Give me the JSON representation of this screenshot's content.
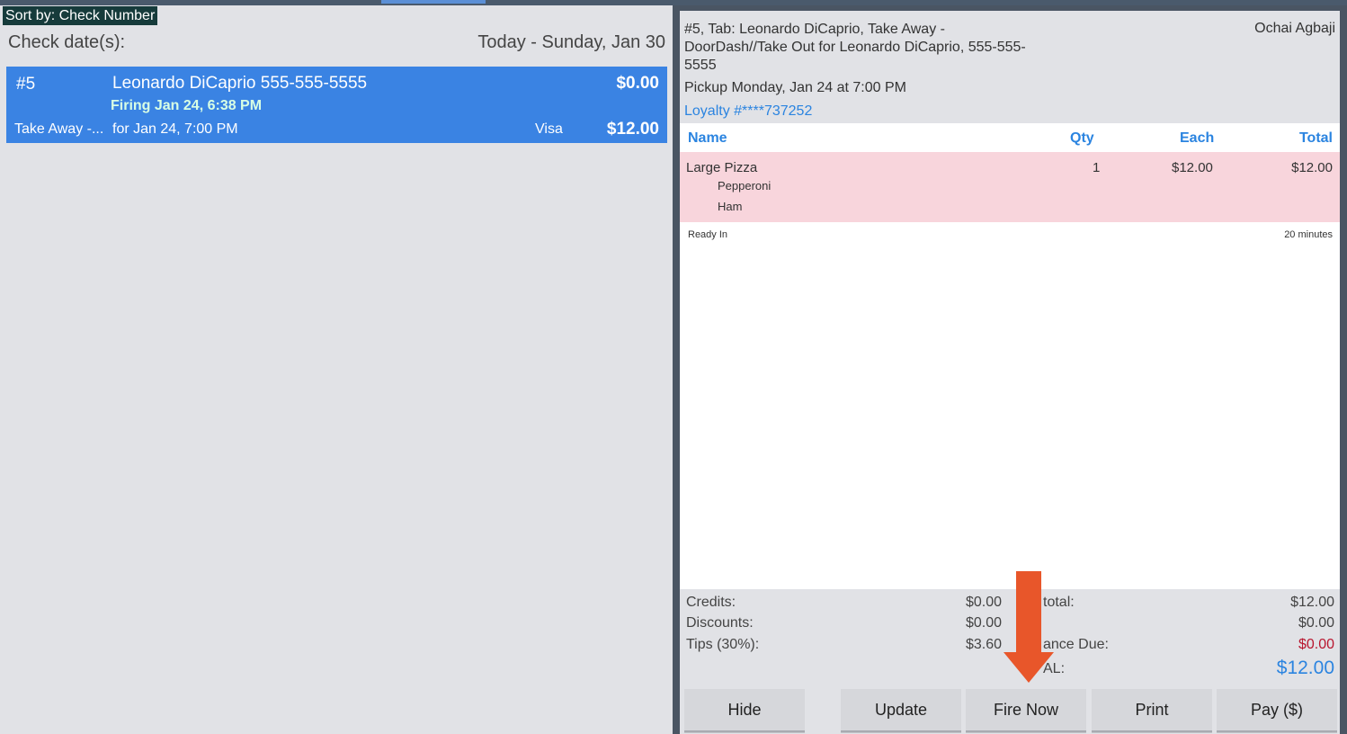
{
  "left": {
    "sort_label": "Sort by: Check Number",
    "check_dates_label": "Check date(s):",
    "check_dates_value": "Today - Sunday, Jan 30",
    "check": {
      "number": "#5",
      "name": "Leonardo DiCaprio 555-555-5555",
      "amount": "$0.00",
      "firing": "Firing Jan 24, 6:38 PM",
      "type": "Take Away -...",
      "for": "for Jan 24, 7:00 PM",
      "payment": "Visa",
      "total": "$12.00"
    }
  },
  "detail": {
    "title": "#5, Tab: Leonardo DiCaprio, Take Away - DoorDash//Take Out for Leonardo DiCaprio, 555-555-5555",
    "server": "Ochai Agbaji",
    "pickup": "Pickup Monday, Jan 24 at 7:00 PM",
    "loyalty": "Loyalty #****737252",
    "columns": {
      "name": "Name",
      "qty": "Qty",
      "each": "Each",
      "total": "Total"
    },
    "item": {
      "name": "Large Pizza",
      "qty": "1",
      "each": "$12.00",
      "total": "$12.00",
      "modifiers": [
        "Pepperoni",
        "Ham"
      ]
    },
    "ready_label": "Ready In",
    "ready_value": "20 minutes",
    "totals": {
      "credits_label": "Credits:",
      "credits_value": "$0.00",
      "discounts_label": "Discounts:",
      "discounts_value": "$0.00",
      "tips_label": "Tips (30%):",
      "tips_value": "$3.60",
      "subtotal_label": "total:",
      "subtotal_value": "$12.00",
      "tax_value": "$0.00",
      "balance_label": "ance Due:",
      "balance_value": "$0.00",
      "total_label": "AL:",
      "total_value": "$12.00"
    },
    "buttons": {
      "hide": "Hide",
      "update": "Update",
      "fire_now": "Fire Now",
      "print": "Print",
      "pay": "Pay ($)"
    }
  },
  "colors": {
    "selection": "#3a83e3",
    "accent": "#2b84e0",
    "item_row": "#f8d5dc",
    "balance_due": "#b8162f",
    "annotation_arrow": "#e8562a"
  },
  "annotation": {
    "icon": "down-arrow-icon"
  }
}
